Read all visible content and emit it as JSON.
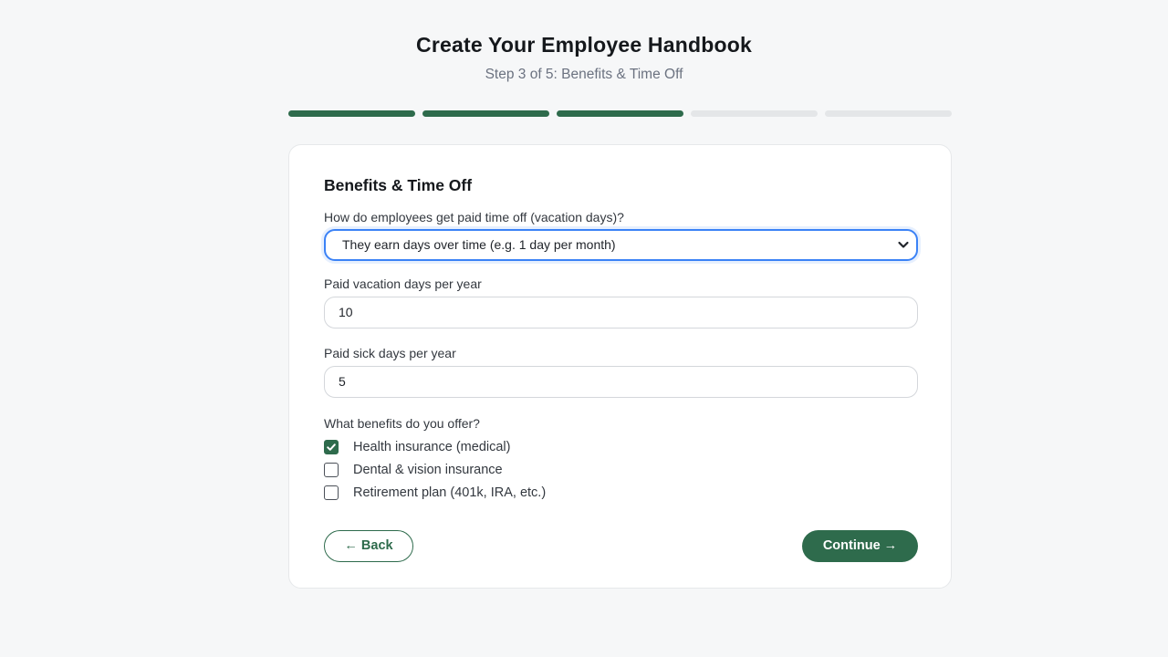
{
  "header": {
    "title": "Create Your Employee Handbook",
    "subtitle": "Step 3 of 5: Benefits & Time Off"
  },
  "progress": {
    "total_steps": 5,
    "completed_steps": 3,
    "complete_color": "#2e6b4c",
    "incomplete_color": "#e4e6e8"
  },
  "form": {
    "section_title": "Benefits & Time Off",
    "pto_method": {
      "label": "How do employees get paid time off (vacation days)?",
      "selected": "They earn days over time (e.g. 1 day per month)",
      "icon": "chevron-down-icon"
    },
    "vacation_days": {
      "label": "Paid vacation days per year",
      "value": "10"
    },
    "sick_days": {
      "label": "Paid sick days per year",
      "value": "5"
    },
    "benefits": {
      "label": "What benefits do you offer?",
      "options": [
        {
          "label": "Health insurance (medical)",
          "checked": true
        },
        {
          "label": "Dental & vision insurance",
          "checked": false
        },
        {
          "label": "Retirement plan (401k, IRA, etc.)",
          "checked": false
        }
      ]
    }
  },
  "actions": {
    "back_label": "← Back",
    "continue_label": "Continue →",
    "accent_color": "#2e6b4c"
  }
}
